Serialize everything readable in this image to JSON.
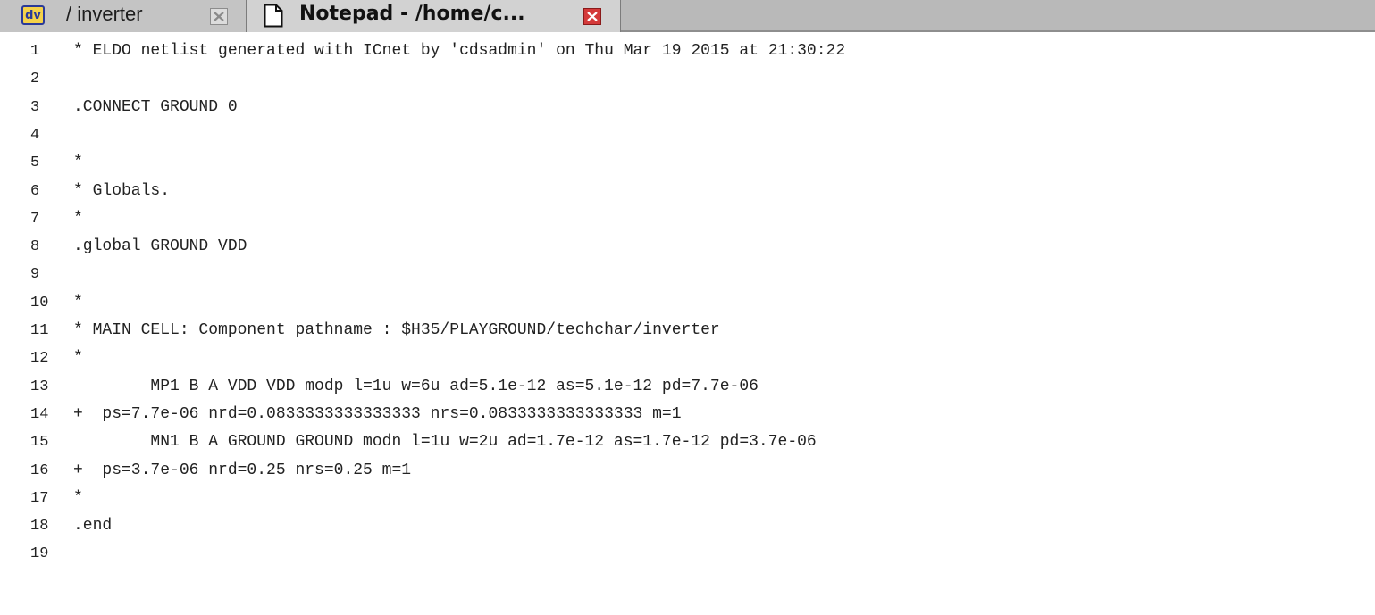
{
  "tabs": [
    {
      "icon": "dv-app-icon",
      "icon_text": "dv",
      "label": "/ inverter",
      "close_icon": "close-gray-icon",
      "active": false
    },
    {
      "icon": "document-icon",
      "label": "Notepad - /home/c...",
      "close_icon": "close-red-icon",
      "active": true
    }
  ],
  "editor": {
    "lines": [
      {
        "n": "1",
        "text": "* ELDO netlist generated with ICnet by 'cdsadmin' on Thu Mar 19 2015 at 21:30:22"
      },
      {
        "n": "2",
        "text": ""
      },
      {
        "n": "3",
        "text": ".CONNECT GROUND 0"
      },
      {
        "n": "4",
        "text": ""
      },
      {
        "n": "5",
        "text": "*"
      },
      {
        "n": "6",
        "text": "* Globals."
      },
      {
        "n": "7",
        "text": "*"
      },
      {
        "n": "8",
        "text": ".global GROUND VDD"
      },
      {
        "n": "9",
        "text": ""
      },
      {
        "n": "10",
        "text": "*"
      },
      {
        "n": "11",
        "text": "* MAIN CELL: Component pathname : $H35/PLAYGROUND/techchar/inverter"
      },
      {
        "n": "12",
        "text": "*"
      },
      {
        "n": "13",
        "text": "        MP1 B A VDD VDD modp l=1u w=6u ad=5.1e-12 as=5.1e-12 pd=7.7e-06"
      },
      {
        "n": "14",
        "text": "+  ps=7.7e-06 nrd=0.0833333333333333 nrs=0.0833333333333333 m=1"
      },
      {
        "n": "15",
        "text": "        MN1 B A GROUND GROUND modn l=1u w=2u ad=1.7e-12 as=1.7e-12 pd=3.7e-06"
      },
      {
        "n": "16",
        "text": "+  ps=3.7e-06 nrd=0.25 nrs=0.25 m=1"
      },
      {
        "n": "17",
        "text": "*"
      },
      {
        "n": "18",
        "text": ".end"
      },
      {
        "n": "19",
        "text": ""
      }
    ]
  },
  "colors": {
    "tabbar_bg": "#b9b9b9",
    "active_tab_bg": "#d2d2d2",
    "close_active": "#d43a3a",
    "text": "#222222"
  }
}
